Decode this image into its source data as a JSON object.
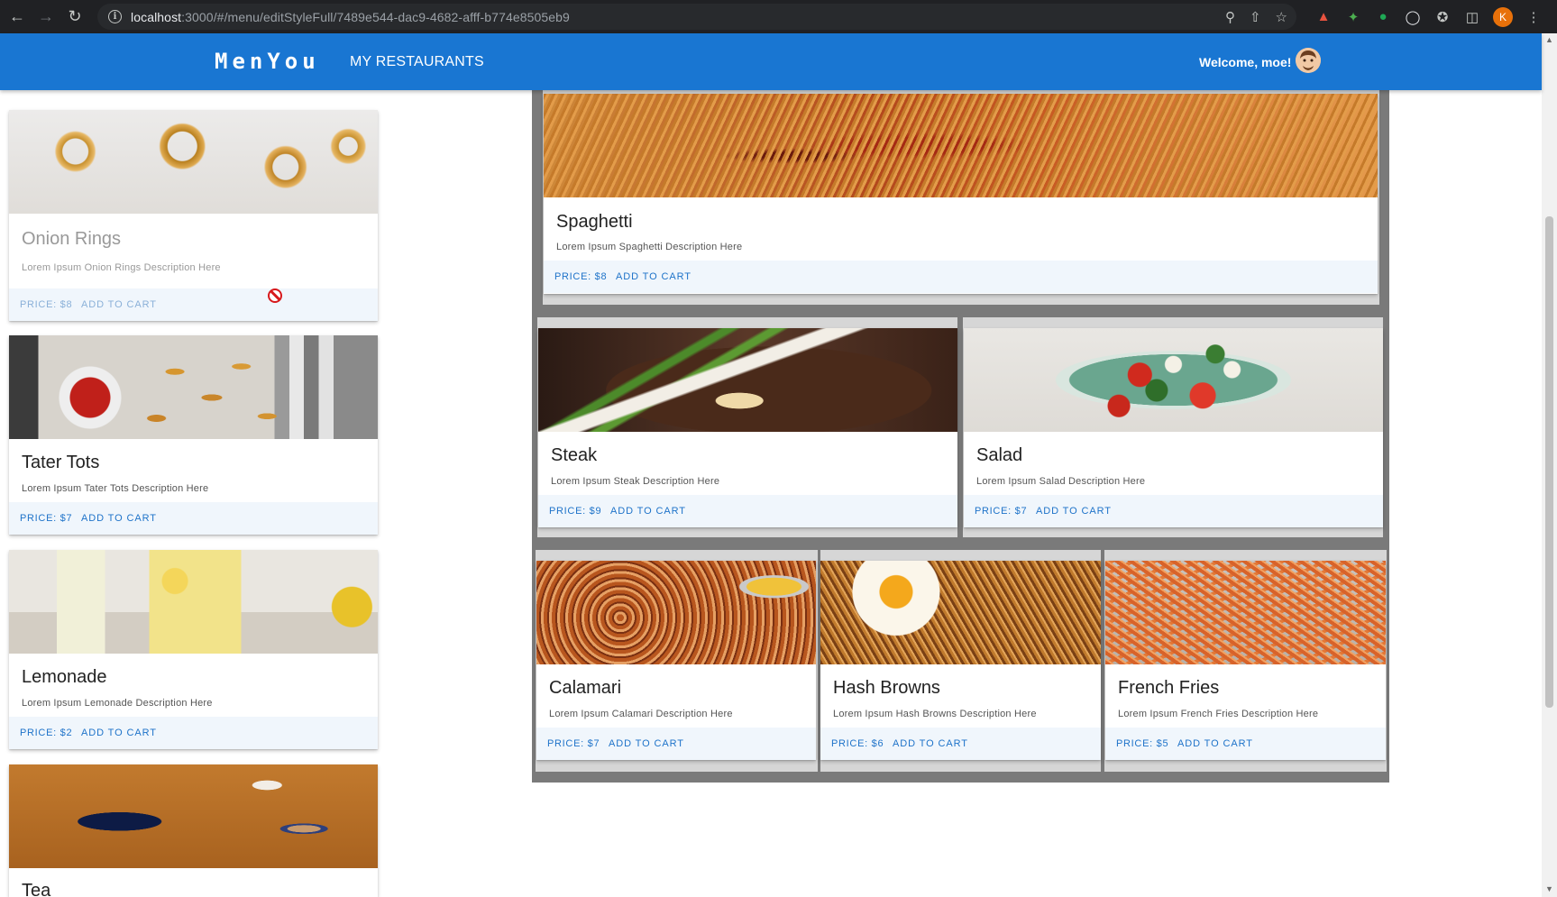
{
  "browser": {
    "url_host": "localhost",
    "url_rest": ":3000/#/menu/editStyleFull/7489e544-dac9-4682-afff-b774e8505eb9",
    "profile_initial": "K",
    "icons": [
      "back-arrow-icon",
      "forward-arrow-icon",
      "reload-icon",
      "info-icon",
      "zoom-icon",
      "share-icon",
      "star-icon",
      "extension-icons",
      "puzzle-icon",
      "sidepanel-icon",
      "kebab-menu-icon"
    ]
  },
  "appbar": {
    "logo": "MenYou",
    "nav_link": "MY RESTAURANTS",
    "welcome": "Welcome, moe!",
    "color": "#1976d2"
  },
  "sidebar_items": [
    {
      "name": "Onion Rings",
      "description": "Lorem Ipsum Onion Rings Description Here",
      "price": "PRICE: $8",
      "add": "ADD TO CART"
    },
    {
      "name": "Tater Tots",
      "description": "Lorem Ipsum Tater Tots Description Here",
      "price": "PRICE: $7",
      "add": "ADD TO CART"
    },
    {
      "name": "Lemonade",
      "description": "Lorem Ipsum Lemonade Description Here",
      "price": "PRICE: $2",
      "add": "ADD TO CART"
    },
    {
      "name": "Tea",
      "description": "",
      "price": "",
      "add": ""
    }
  ],
  "layout_rows": [
    [
      {
        "name": "Spaghetti",
        "description": "Lorem Ipsum Spaghetti Description Here",
        "price": "PRICE: $8",
        "add": "ADD TO CART"
      }
    ],
    [
      {
        "name": "Steak",
        "description": "Lorem Ipsum Steak Description Here",
        "price": "PRICE: $9",
        "add": "ADD TO CART"
      },
      {
        "name": "Salad",
        "description": "Lorem Ipsum Salad Description Here",
        "price": "PRICE: $7",
        "add": "ADD TO CART"
      }
    ],
    [
      {
        "name": "Calamari",
        "description": "Lorem Ipsum Calamari Description Here",
        "price": "PRICE: $7",
        "add": "ADD TO CART"
      },
      {
        "name": "Hash Browns",
        "description": "Lorem Ipsum Hash Browns Description Here",
        "price": "PRICE: $6",
        "add": "ADD TO CART"
      },
      {
        "name": "French Fries",
        "description": "Lorem Ipsum French Fries Description Here",
        "price": "PRICE: $5",
        "add": "ADD TO CART"
      }
    ]
  ],
  "accent_color": "#1e73c9"
}
